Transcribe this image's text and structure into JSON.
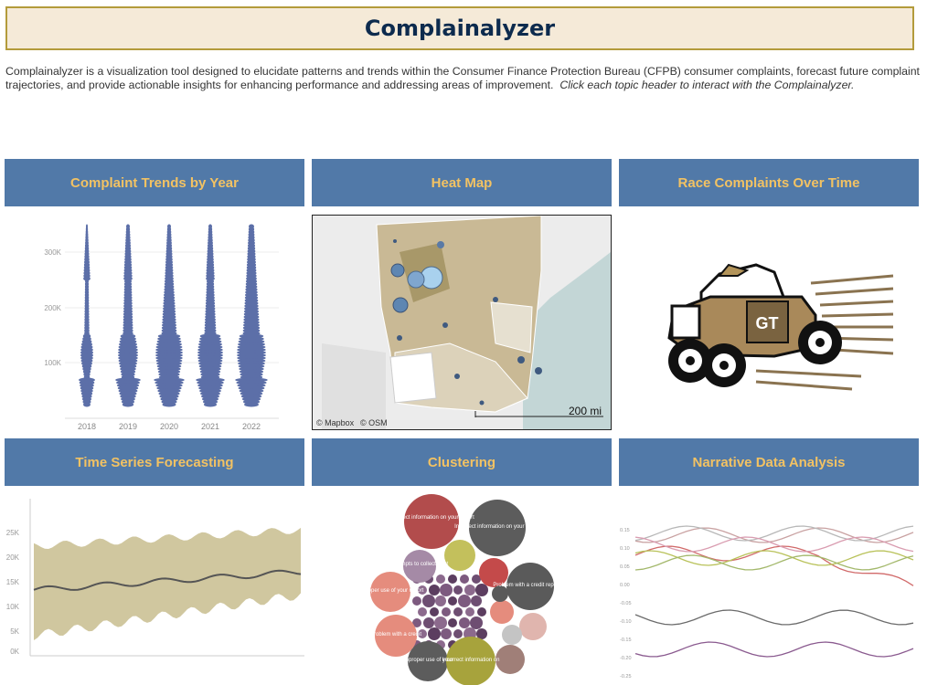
{
  "header": {
    "title": "Complainalyzer"
  },
  "intro": {
    "text": "Complainalyzer is a visualization tool designed to elucidate patterns and trends within the Consumer Finance Protection Bureau (CFPB) consumer complaints, forecast future complaint trajectories, and provide actionable insights for enhancing performance and addressing areas of improvement.",
    "instruction": "Click each topic header to interact with the Complainalyzer."
  },
  "tiles": [
    {
      "label": "Complaint Trends by Year"
    },
    {
      "label": "Heat Map"
    },
    {
      "label": "Race Complaints Over Time"
    },
    {
      "label": "Time Series Forecasting"
    },
    {
      "label": "Clustering"
    },
    {
      "label": "Narrative Data Analysis"
    }
  ],
  "colors": {
    "header_bg": "#5179a8",
    "header_text": "#f2c263",
    "title_bg": "#f5ead8",
    "title_border": "#b39b3b",
    "title_text": "#0d2b4e"
  },
  "trends_chart": {
    "y_ticks": [
      "300K",
      "200K",
      "100K"
    ],
    "years": [
      "2018",
      "2019",
      "2020",
      "2021",
      "2022"
    ]
  },
  "map": {
    "scale_label": "200 mi",
    "attribution_mapbox": "© Mapbox",
    "attribution_osm": "© OSM"
  },
  "race_image": {
    "emblem": "GT",
    "icon": "car-icon"
  },
  "forecast_chart": {
    "y_ticks": [
      "25K",
      "20K",
      "15K",
      "10K",
      "5K",
      "0K"
    ]
  },
  "clusters": {
    "labels": [
      "Incorrect information on your report",
      "Incorrect information on your report",
      "Attempts to collect debt",
      "Problem with a credit reporting",
      "Improper use of your report",
      "Problem with a credit",
      "Improper use of your",
      "Incorrect information on"
    ]
  },
  "narrative_chart": {
    "y_ticks": [
      "0.15",
      "0.10",
      "0.05",
      "0.00",
      "-0.05",
      "-0.10",
      "-0.15",
      "-0.20",
      "-0.25"
    ]
  }
}
